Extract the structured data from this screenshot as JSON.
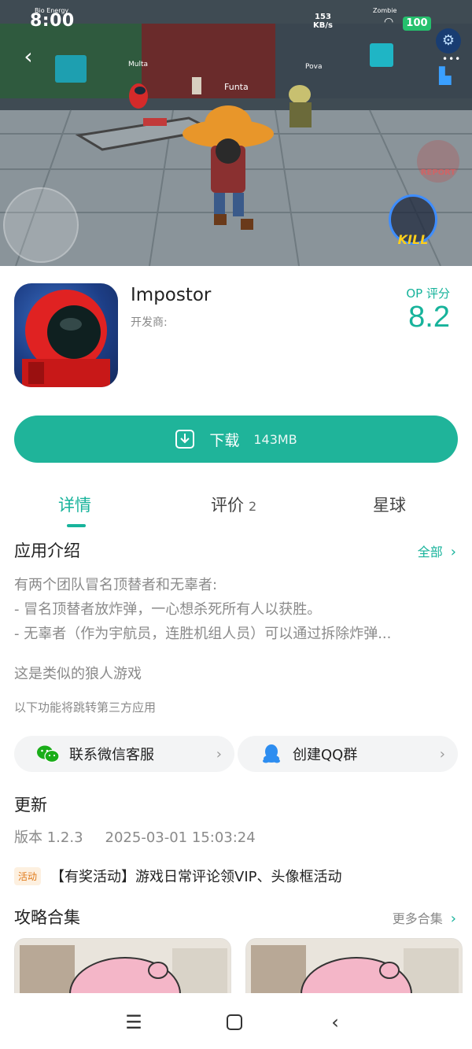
{
  "status_bar": {
    "time": "8:00",
    "hud_name": "Bio Energy",
    "net_speed": "153",
    "net_unit": "KB/s",
    "zombie_label": "Zombie",
    "battery": "100"
  },
  "game": {
    "characters": [
      "Multa",
      "Pova"
    ],
    "player_name": "Funta",
    "kill_label": "KILL",
    "report_label": "REPORT"
  },
  "app": {
    "title": "Impostor",
    "developer_label": "开发商:",
    "score_label": "OP 评分",
    "score_value": "8.2"
  },
  "download": {
    "label": "下载",
    "size": "143MB"
  },
  "tabs": [
    {
      "label": "详情",
      "count": ""
    },
    {
      "label": "评价",
      "count": "2"
    },
    {
      "label": "星球",
      "count": ""
    }
  ],
  "intro": {
    "title": "应用介绍",
    "see_all": "全部",
    "lines": [
      "有两个团队冒名顶替者和无辜者:",
      "- 冒名顶替者放炸弹，一心想杀死所有人以获胜。",
      "- 无辜者（作为宇航员，连胜机组人员）可以通过拆除炸弹..."
    ],
    "similar": "这是类似的狼人游戏",
    "redirect_note": "以下功能将跳转第三方应用"
  },
  "contacts": {
    "wechat": "联系微信客服",
    "qq": "创建QQ群"
  },
  "update": {
    "title": "更新",
    "version": "版本 1.2.3",
    "date": "2025-03-01 15:03:24"
  },
  "activity": {
    "tag": "活动",
    "text": "【有奖活动】游戏日常评论领VIP、头像框活动"
  },
  "guides": {
    "title": "攻略合集",
    "more": "更多合集"
  },
  "colors": {
    "accent": "#1fb49a",
    "accent_text": "#17b39b"
  }
}
